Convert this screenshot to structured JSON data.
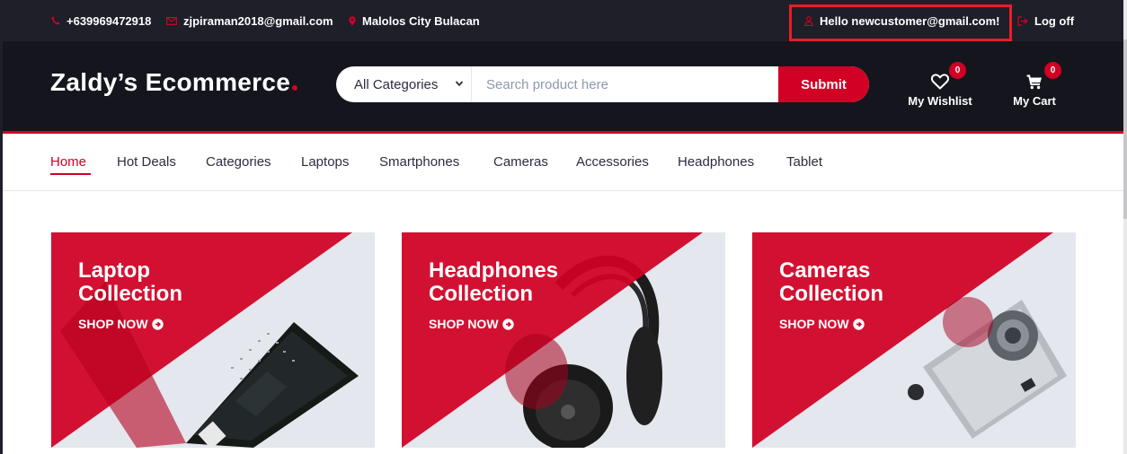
{
  "topbar": {
    "phone": "+639969472918",
    "email": "zjpiraman2018@gmail.com",
    "location": "Malolos City Bulacan",
    "greeting": "Hello newcustomer@gmail.com!",
    "logoff_label": "Log off"
  },
  "header": {
    "logo_text": "Zaldy’s Ecommerce",
    "search": {
      "category_value": "All Categories",
      "placeholder": "Search product here",
      "submit_label": "Submit"
    },
    "wishlist": {
      "label": "My Wishlist",
      "count": "0"
    },
    "cart": {
      "label": "My Cart",
      "count": "0"
    }
  },
  "nav": {
    "items": [
      "Home",
      "Hot Deals",
      "Categories",
      "Laptops",
      "Smartphones",
      "Cameras",
      "Accessories",
      "Headphones",
      "Tablet"
    ],
    "active": "Home"
  },
  "collections": [
    {
      "line1": "Laptop",
      "line2": "Collection",
      "cta": "SHOP NOW"
    },
    {
      "line1": "Headphones",
      "line2": "Collection",
      "cta": "SHOP NOW"
    },
    {
      "line1": "Cameras",
      "line2": "Collection",
      "cta": "SHOP NOW"
    }
  ],
  "colors": {
    "brand_red": "#d10024",
    "dark": "#15161d",
    "topbar": "#1e1f29",
    "card_bg": "#e4e7ed"
  },
  "icons": [
    "phone-icon",
    "envelope-icon",
    "map-marker-icon",
    "user-icon",
    "logout-icon",
    "heart-icon",
    "cart-icon",
    "chevron-down-icon",
    "arrow-circle-right-icon"
  ]
}
